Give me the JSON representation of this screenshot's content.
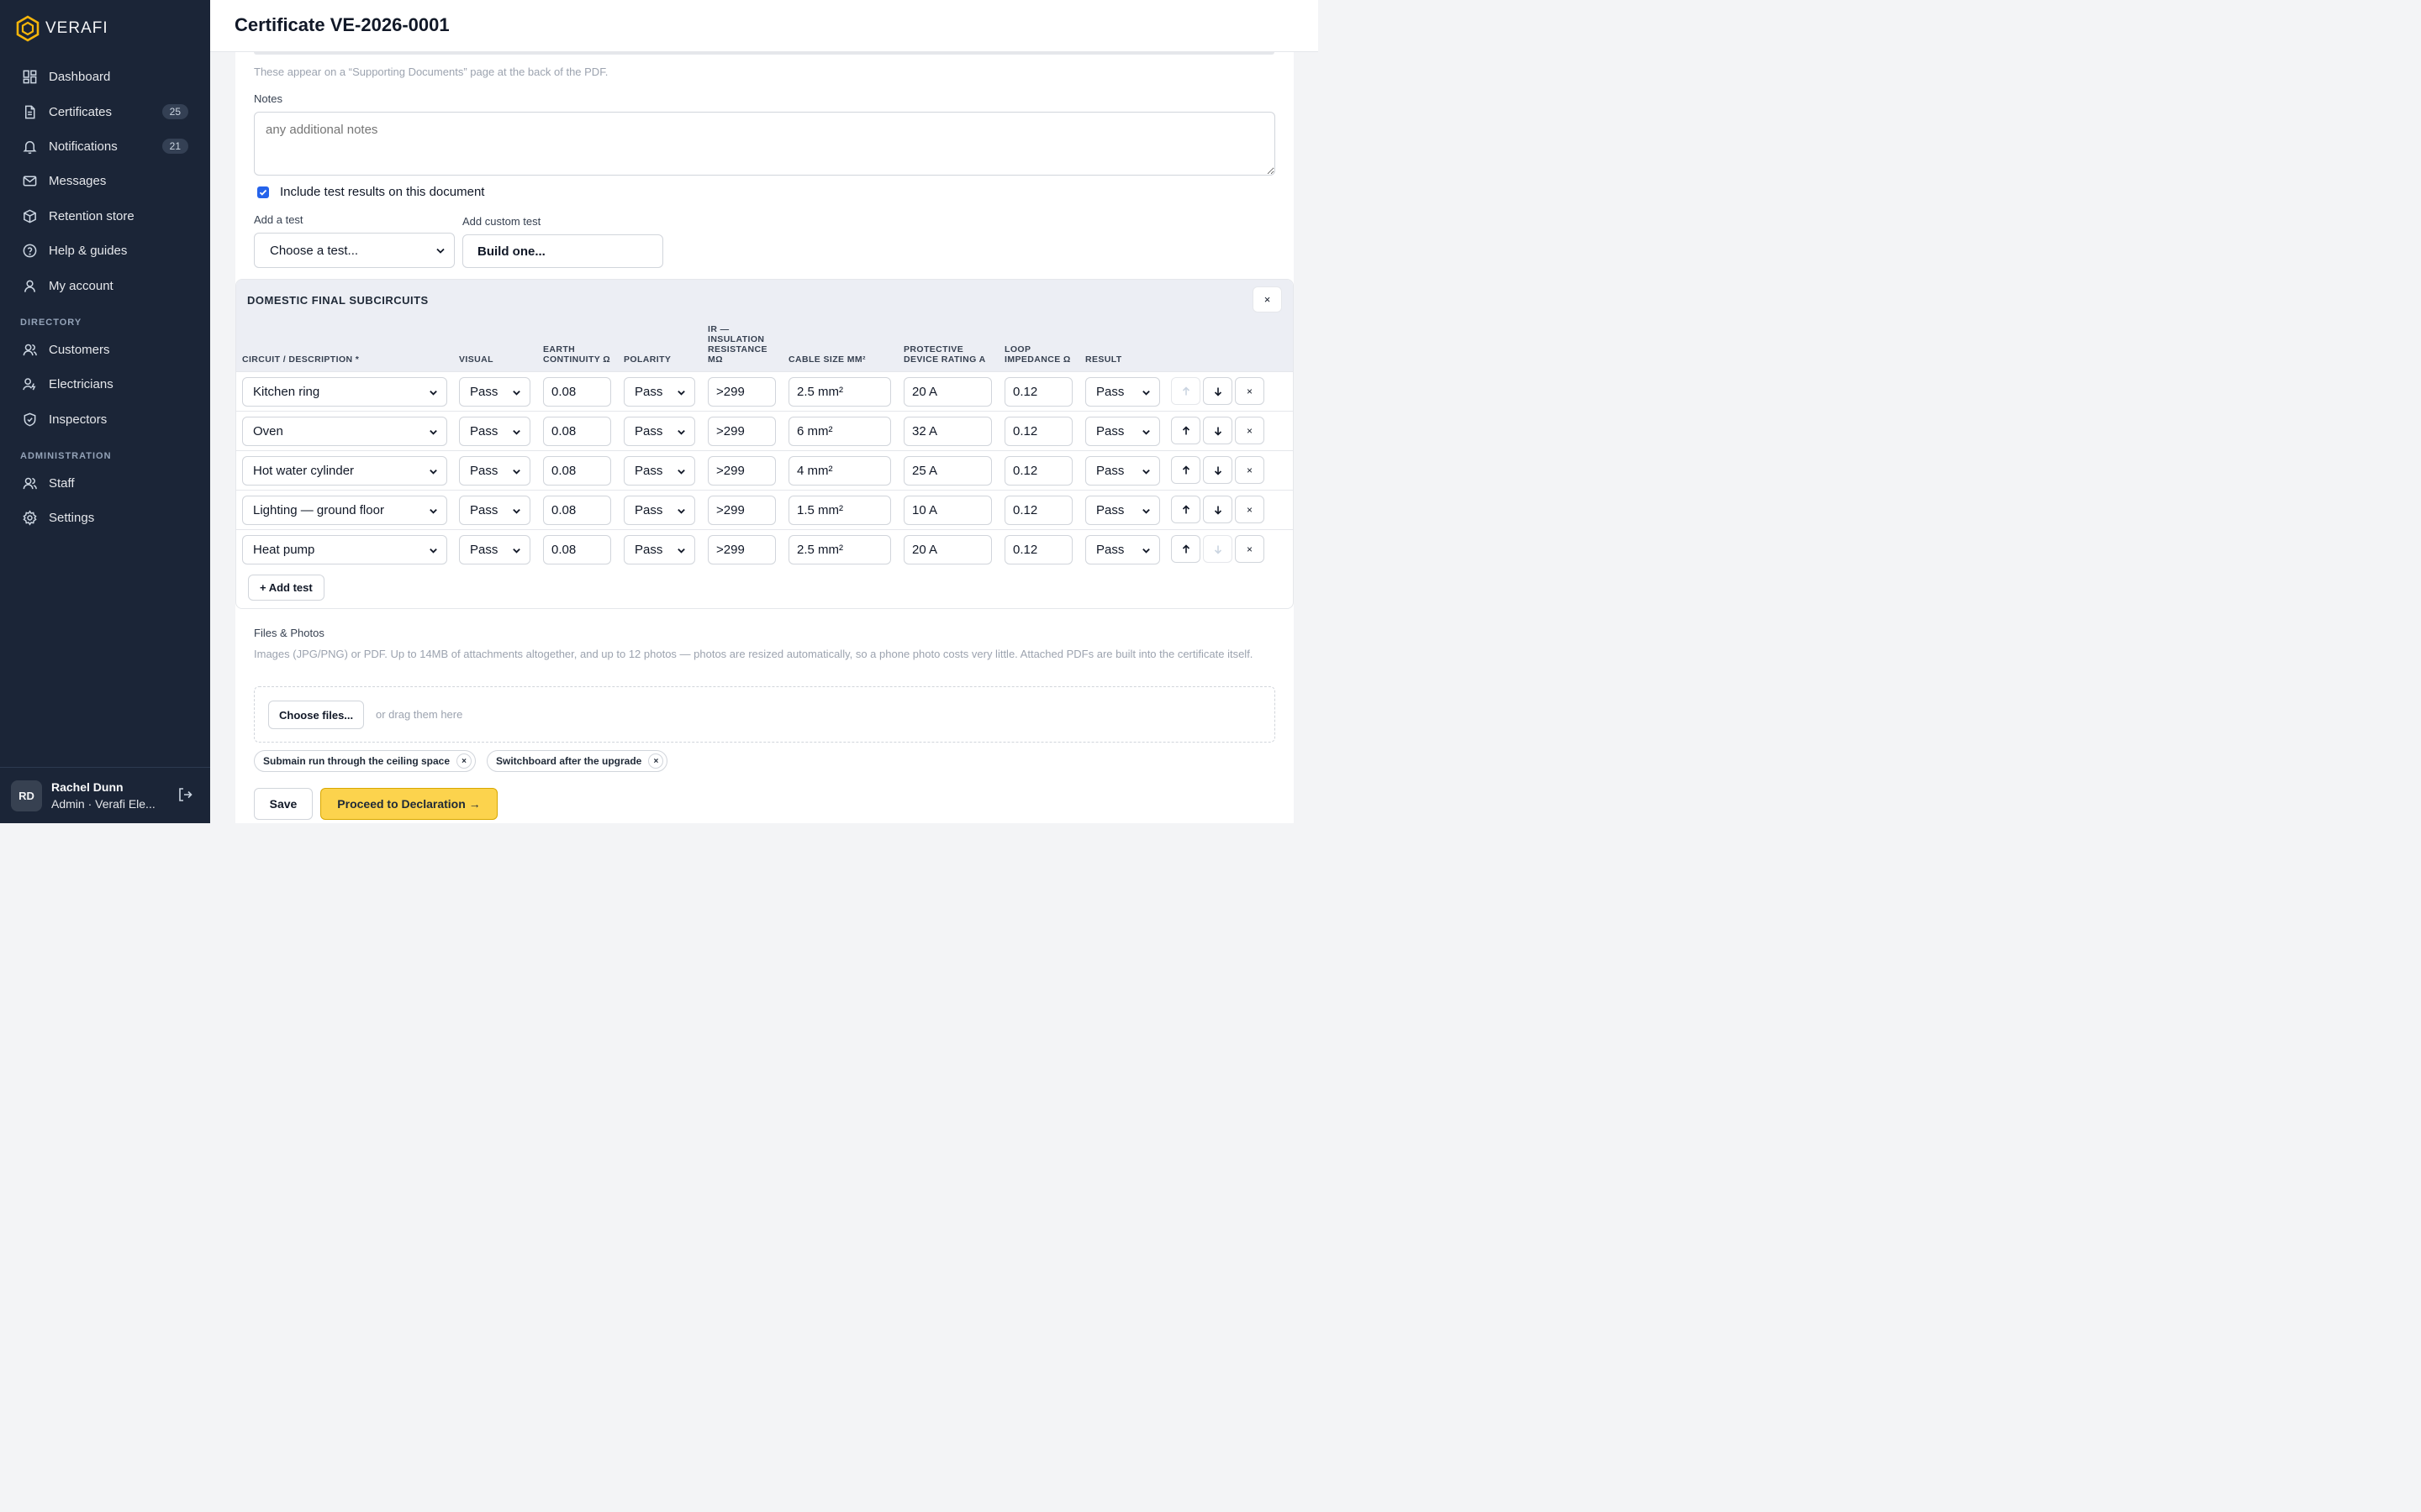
{
  "brand": {
    "name": "VERAFI"
  },
  "sidebar": {
    "nav": [
      {
        "label": "Dashboard",
        "icon": "dashboard-icon"
      },
      {
        "label": "Certificates",
        "icon": "document-icon",
        "badge": "25"
      },
      {
        "label": "Notifications",
        "icon": "bell-icon",
        "badge": "21"
      },
      {
        "label": "Messages",
        "icon": "mail-icon"
      },
      {
        "label": "Retention store",
        "icon": "box-icon"
      },
      {
        "label": "Help & guides",
        "icon": "help-icon"
      },
      {
        "label": "My account",
        "icon": "user-icon"
      }
    ],
    "directory_heading": "DIRECTORY",
    "directory": [
      {
        "label": "Customers",
        "icon": "users-icon"
      },
      {
        "label": "Electricians",
        "icon": "electrician-icon"
      },
      {
        "label": "Inspectors",
        "icon": "shield-icon"
      }
    ],
    "admin_heading": "ADMINISTRATION",
    "admin": [
      {
        "label": "Staff",
        "icon": "staff-icon"
      },
      {
        "label": "Settings",
        "icon": "gear-icon"
      }
    ],
    "user": {
      "initials": "RD",
      "name": "Rachel Dunn",
      "role": "Admin · Verafi Ele..."
    }
  },
  "header": {
    "title": "Certificate VE-2026-0001"
  },
  "form": {
    "supporting_help": "These appear on a “Supporting Documents” page at the back of the PDF.",
    "notes_label": "Notes",
    "notes_placeholder": "any additional notes",
    "include_tests_label": "Include test results on this document",
    "add_test_label": "Add a test",
    "add_test_value": "Choose a test...",
    "add_custom_label": "Add custom test",
    "add_custom_button": "Build one..."
  },
  "test_panel": {
    "title": "DOMESTIC FINAL SUBCIRCUITS",
    "close_label": "×",
    "columns": {
      "circuit": "CIRCUIT / DESCRIPTION *",
      "visual": "VISUAL",
      "earth": "EARTH CONTINUITY Ω",
      "polarity": "POLARITY",
      "ir": "IR — INSULATION RESISTANCE MΩ",
      "cable": "CABLE SIZE MM²",
      "device": "PROTECTIVE DEVICE RATING A",
      "loop": "LOOP IMPEDANCE Ω",
      "result": "RESULT"
    },
    "rows": [
      {
        "circuit": "Kitchen ring",
        "visual": "Pass",
        "earth": "0.08",
        "polarity": "Pass",
        "ir": ">299",
        "cable": "2.5 mm²",
        "device": "20 A",
        "loop": "0.12",
        "result": "Pass"
      },
      {
        "circuit": "Oven",
        "visual": "Pass",
        "earth": "0.08",
        "polarity": "Pass",
        "ir": ">299",
        "cable": "6 mm²",
        "device": "32 A",
        "loop": "0.12",
        "result": "Pass"
      },
      {
        "circuit": "Hot water cylinder",
        "visual": "Pass",
        "earth": "0.08",
        "polarity": "Pass",
        "ir": ">299",
        "cable": "4 mm²",
        "device": "25 A",
        "loop": "0.12",
        "result": "Pass"
      },
      {
        "circuit": "Lighting — ground floor",
        "visual": "Pass",
        "earth": "0.08",
        "polarity": "Pass",
        "ir": ">299",
        "cable": "1.5 mm²",
        "device": "10 A",
        "loop": "0.12",
        "result": "Pass"
      },
      {
        "circuit": "Heat pump",
        "visual": "Pass",
        "earth": "0.08",
        "polarity": "Pass",
        "ir": ">299",
        "cable": "2.5 mm²",
        "device": "20 A",
        "loop": "0.12",
        "result": "Pass"
      }
    ],
    "add_test_button": "+ Add test"
  },
  "files": {
    "label": "Files & Photos",
    "help": "Images (JPG/PNG) or PDF. Up to 14MB of attachments altogether, and up to 12 photos — photos are resized automatically, so a phone photo costs very little. Attached PDFs are built into the certificate itself.",
    "choose_button": "Choose files...",
    "drag_text": "or drag them here",
    "attachments": [
      "Submain run through the ceiling space",
      "Switchboard after the upgrade"
    ]
  },
  "actions": {
    "save": "Save",
    "proceed": "Proceed to Declaration →"
  },
  "colors": {
    "sidebar_bg": "#1b2537",
    "accent_yellow": "#fcd34d",
    "checkbox_blue": "#2563eb",
    "brand_logo": "#f5b50a"
  }
}
